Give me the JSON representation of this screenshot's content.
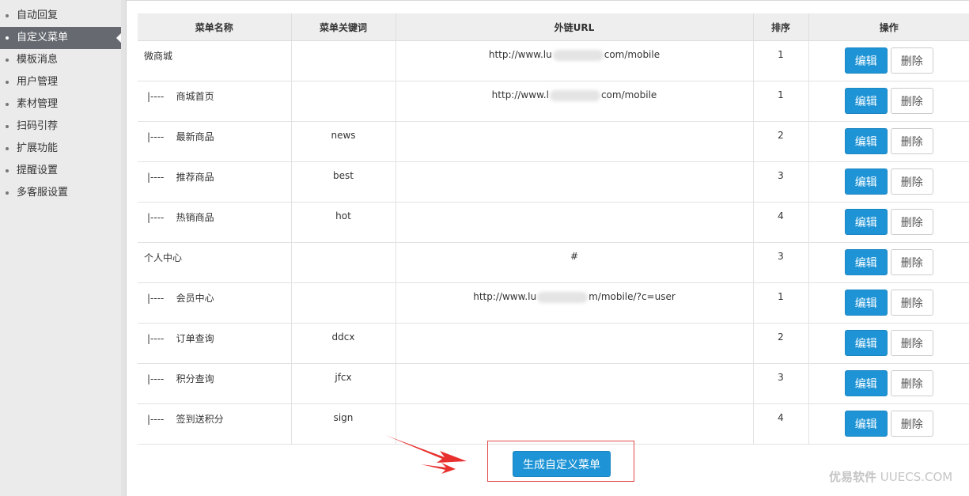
{
  "sidebar": {
    "items": [
      {
        "label": "自动回复",
        "active": false
      },
      {
        "label": "自定义菜单",
        "active": true
      },
      {
        "label": "模板消息",
        "active": false
      },
      {
        "label": "用户管理",
        "active": false
      },
      {
        "label": "素材管理",
        "active": false
      },
      {
        "label": "扫码引荐",
        "active": false
      },
      {
        "label": "扩展功能",
        "active": false
      },
      {
        "label": "提醒设置",
        "active": false
      },
      {
        "label": "多客服设置",
        "active": false
      }
    ]
  },
  "table": {
    "headers": [
      "菜单名称",
      "菜单关键词",
      "外链URL",
      "排序",
      "操作"
    ],
    "rows": [
      {
        "name": "微商城",
        "sub": false,
        "keyword": "",
        "url_prefix": "http://www.lu",
        "url_suffix": "com/mobile",
        "blurred": true,
        "order": "1"
      },
      {
        "name": "|----    商城首页",
        "sub": true,
        "keyword": "",
        "url_prefix": "http://www.l",
        "url_suffix": "com/mobile",
        "blurred": true,
        "order": "1"
      },
      {
        "name": "|----    最新商品",
        "sub": true,
        "keyword": "news",
        "url_prefix": "",
        "url_suffix": "",
        "blurred": false,
        "order": "2"
      },
      {
        "name": "|----    推荐商品",
        "sub": true,
        "keyword": "best",
        "url_prefix": "",
        "url_suffix": "",
        "blurred": false,
        "order": "3"
      },
      {
        "name": "|----    热销商品",
        "sub": true,
        "keyword": "hot",
        "url_prefix": "",
        "url_suffix": "",
        "blurred": false,
        "order": "4"
      },
      {
        "name": "个人中心",
        "sub": false,
        "keyword": "",
        "url_prefix": "#",
        "url_suffix": "",
        "blurred": false,
        "order": "3"
      },
      {
        "name": "|----    会员中心",
        "sub": true,
        "keyword": "",
        "url_prefix": "http://www.lu",
        "url_suffix": "m/mobile/?c=user",
        "blurred": true,
        "order": "1"
      },
      {
        "name": "|----    订单查询",
        "sub": true,
        "keyword": "ddcx",
        "url_prefix": "",
        "url_suffix": "",
        "blurred": false,
        "order": "2"
      },
      {
        "name": "|----    积分查询",
        "sub": true,
        "keyword": "jfcx",
        "url_prefix": "",
        "url_suffix": "",
        "blurred": false,
        "order": "3"
      },
      {
        "name": "|----    签到送积分",
        "sub": true,
        "keyword": "sign",
        "url_prefix": "",
        "url_suffix": "",
        "blurred": false,
        "order": "4"
      }
    ],
    "edit_label": "编辑",
    "delete_label": "删除"
  },
  "actions": {
    "generate_label": "生成自定义菜单"
  },
  "watermark": {
    "brand": "优易软件",
    "domain": "UUECS.COM"
  },
  "colors": {
    "primary": "#1e94d6",
    "active_nav": "#666a70",
    "highlight_border": "#e14b4b",
    "arrow": "#e8312f"
  }
}
